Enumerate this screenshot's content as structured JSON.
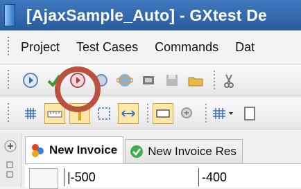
{
  "window": {
    "title": "[AjaxSample_Auto]  -  GXtest De"
  },
  "menu": {
    "items": [
      "Project",
      "Test Cases",
      "Commands",
      "Dat"
    ]
  },
  "toolbar1": {
    "buttons": [
      "record-icon",
      "check-icon",
      "play-record-icon",
      "refresh-icon",
      "browser-icon",
      "navigate-icon",
      "save-icon",
      "open-folder-icon",
      "cut-icon"
    ]
  },
  "toolbar2": {
    "buttons": [
      "grid-icon",
      "ruler-icon",
      "vertical-line-icon",
      "selection-icon",
      "horizontal-resize-icon",
      "window-icon",
      "zoom-icon",
      "table-dropdown-icon",
      "page-icon"
    ]
  },
  "tabs": [
    {
      "label": "New Invoice",
      "icon": "app-icon",
      "active": true
    },
    {
      "label": "New Invoice Res",
      "icon": "check-circle-icon",
      "active": false
    }
  ],
  "grid": {
    "cells": [
      "|-500",
      "-400"
    ]
  },
  "colors": {
    "title_bg": "#2f66ad",
    "highlight_circle": "#b9523e"
  }
}
